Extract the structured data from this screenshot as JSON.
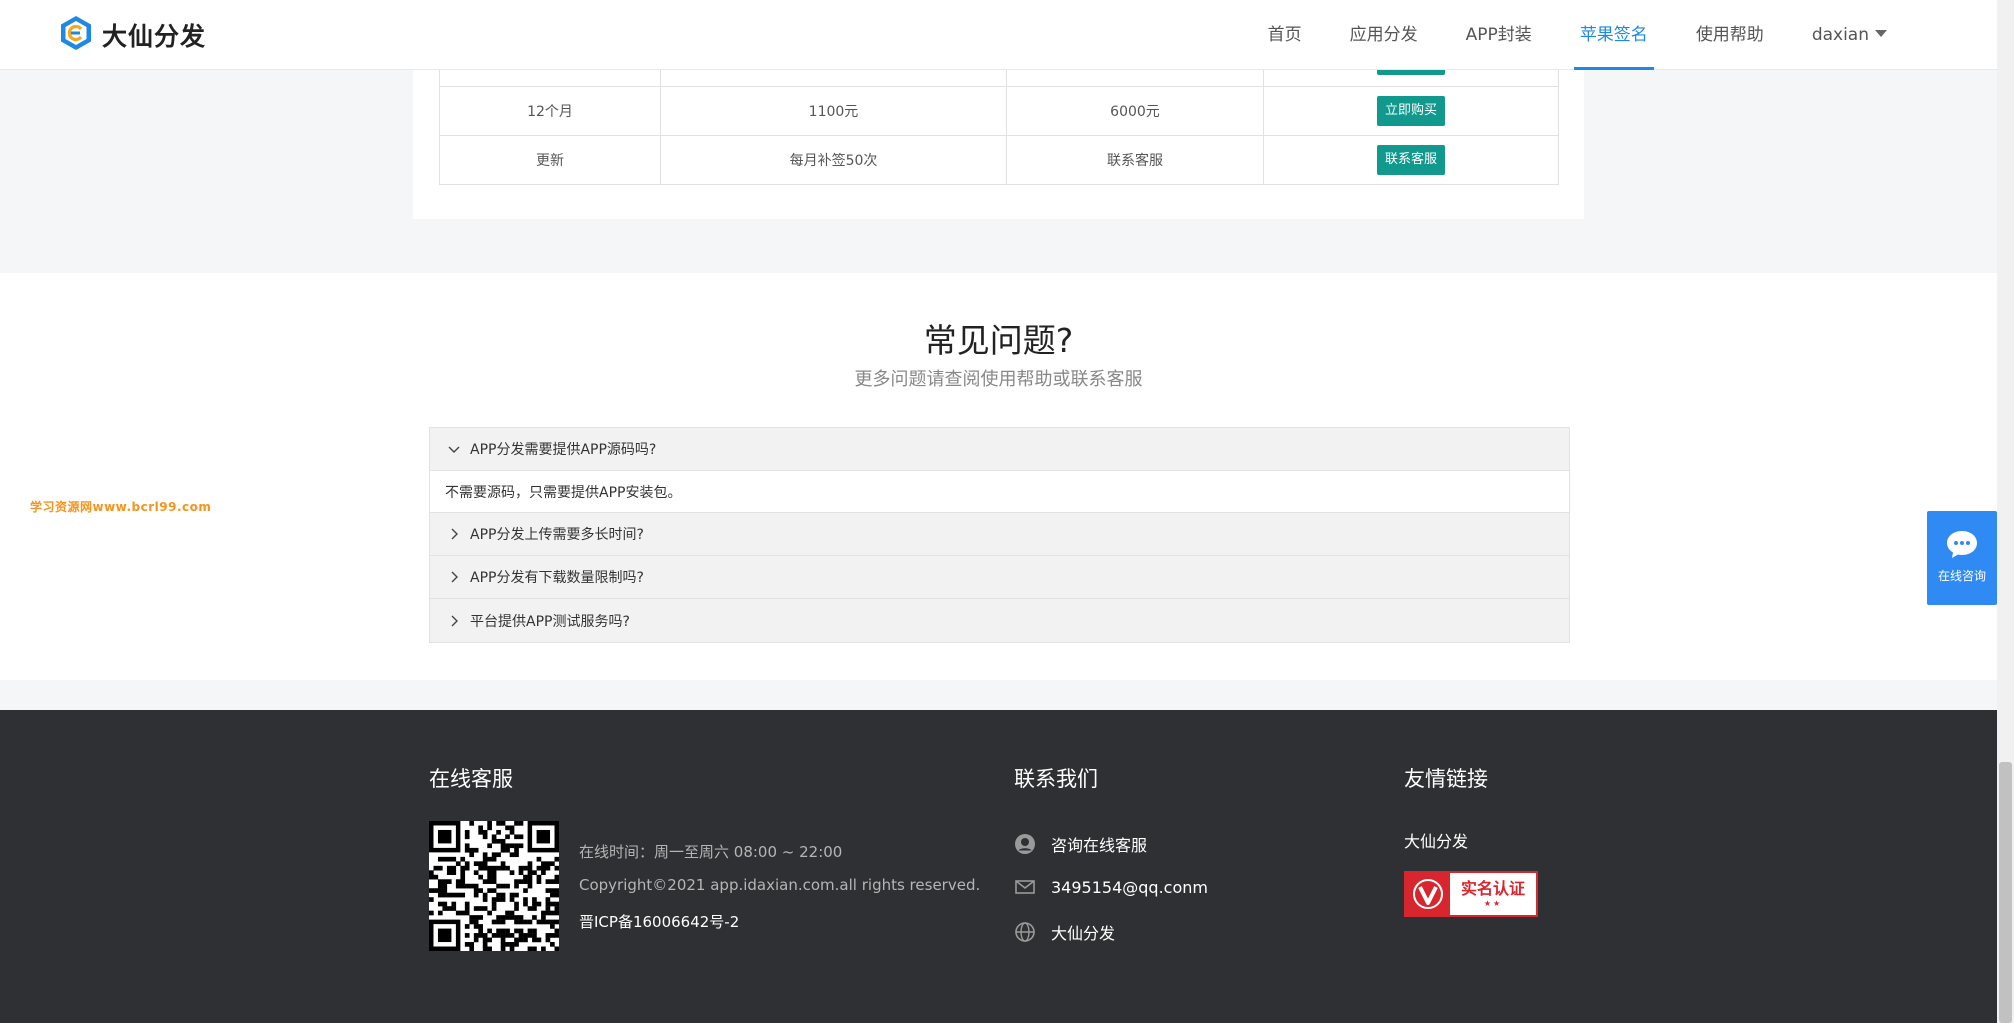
{
  "header": {
    "brand": "大仙分发",
    "nav": [
      {
        "label": "首页",
        "active": false
      },
      {
        "label": "应用分发",
        "active": false
      },
      {
        "label": "APP封装",
        "active": false
      },
      {
        "label": "苹果签名",
        "active": true
      },
      {
        "label": "使用帮助",
        "active": false
      }
    ],
    "user": "daxian"
  },
  "pricing": {
    "rows": [
      {
        "period": "12个月",
        "price1": "1100元",
        "price2": "6000元",
        "action": "立即购买"
      },
      {
        "period": "更新",
        "price1": "每月补签50次",
        "price2": "联系客服",
        "action": "联系客服"
      }
    ]
  },
  "faq": {
    "title": "常见问题?",
    "subtitle": "更多问题请查阅使用帮助或联系客服",
    "items": [
      {
        "question": "APP分发需要提供APP源码吗?",
        "answer": "不需要源码，只需要提供APP安装包。",
        "open": true
      },
      {
        "question": "APP分发上传需要多长时间?",
        "open": false
      },
      {
        "question": "APP分发有下载数量限制吗?",
        "open": false
      },
      {
        "question": "平台提供APP测试服务吗?",
        "open": false
      }
    ]
  },
  "watermark": "学习资源网www.bcrl99.com",
  "float_chat": {
    "label": "在线咨询"
  },
  "footer": {
    "service": {
      "title": "在线客服",
      "hours": "在线时间：周一至周六 08:00 ~ 22:00",
      "copyright": "Copyright©2021 app.idaxian.com.all rights reserved.",
      "icp": "晋ICP备16006642号-2"
    },
    "contact": {
      "title": "联系我们",
      "items": [
        {
          "icon": "headset-icon",
          "text": "咨询在线客服"
        },
        {
          "icon": "mail-icon",
          "text": "3495154@qq.conm"
        },
        {
          "icon": "globe-icon",
          "text": "大仙分发"
        }
      ]
    },
    "links": {
      "title": "友情链接",
      "items": [
        "大仙分发"
      ],
      "badge": {
        "text": "实名认证",
        "stars": "★★"
      }
    }
  },
  "colors": {
    "accent": "#1e88e5",
    "button": "#11998e",
    "footer_bg": "#2f3033",
    "chat_bg": "#2f8bf3",
    "badge_red": "#d7262e"
  }
}
